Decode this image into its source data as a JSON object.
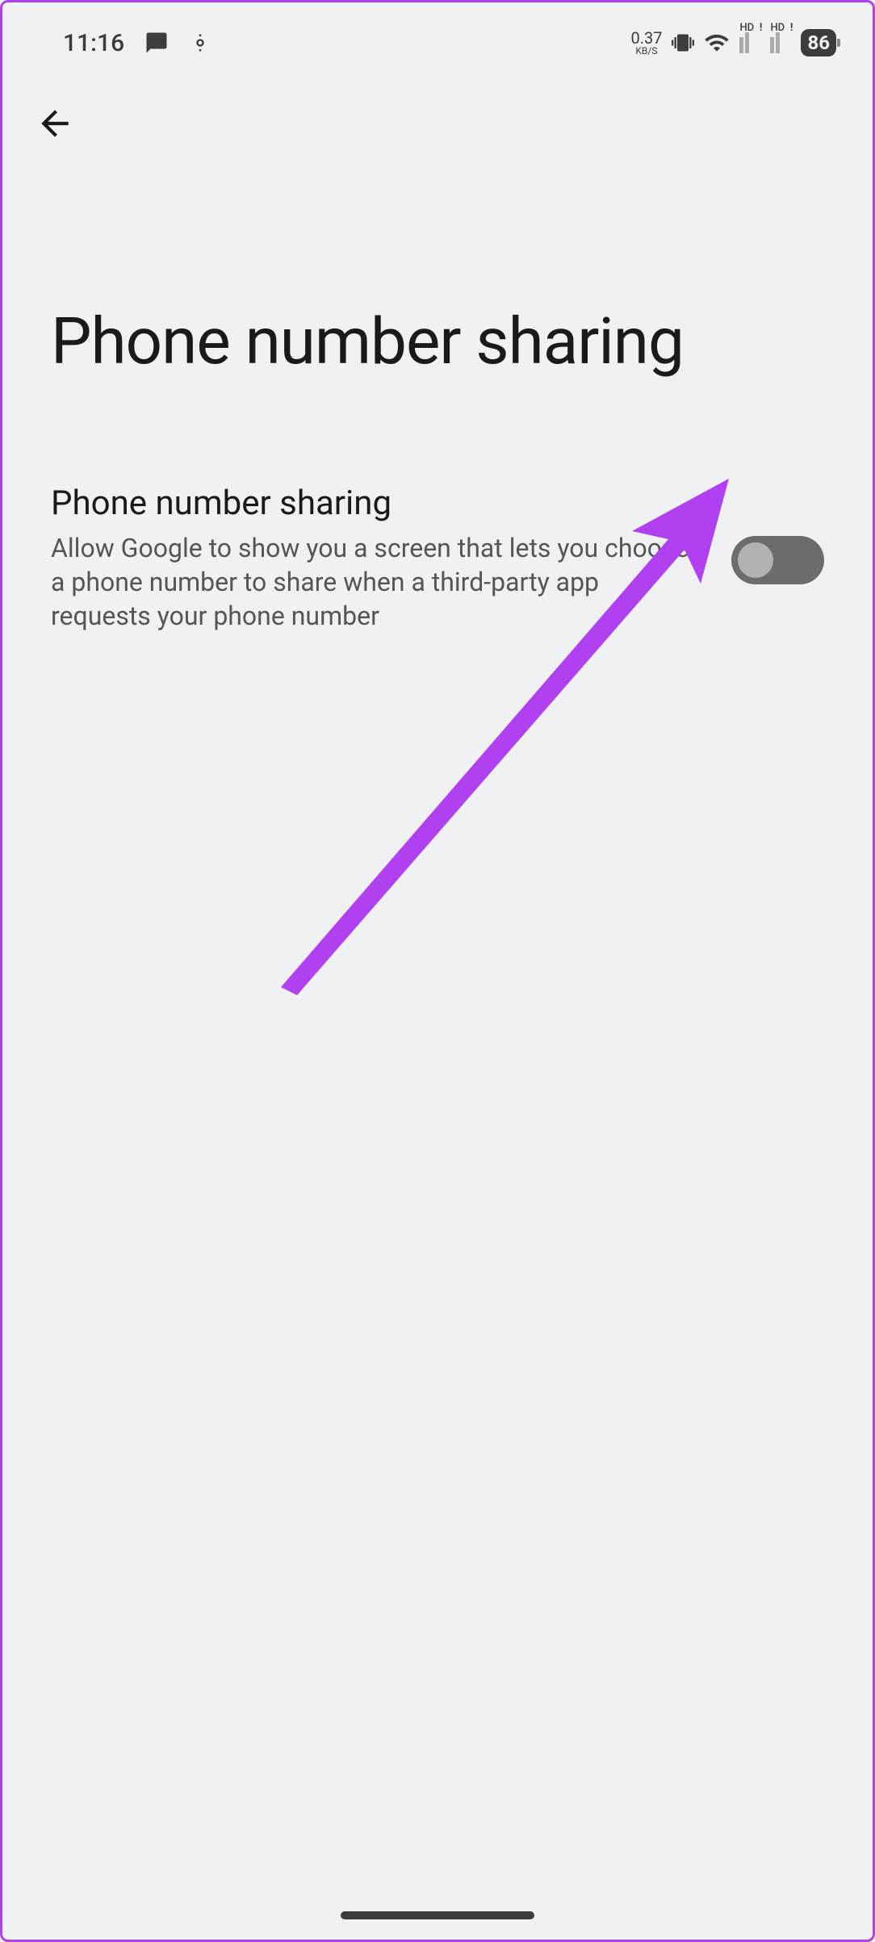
{
  "status_bar": {
    "time": "11:16",
    "speed_value": "0.37",
    "speed_unit": "KB/S",
    "battery": "86",
    "hd1": "HD",
    "hd2": "HD"
  },
  "header": {
    "title": "Phone number sharing"
  },
  "setting": {
    "title": "Phone number sharing",
    "description": "Allow Google to show you a screen that lets you choose a phone number to share when a third-party app requests your phone number",
    "toggle_state": "off"
  },
  "annotation": {
    "arrow_color": "#b040f0"
  }
}
